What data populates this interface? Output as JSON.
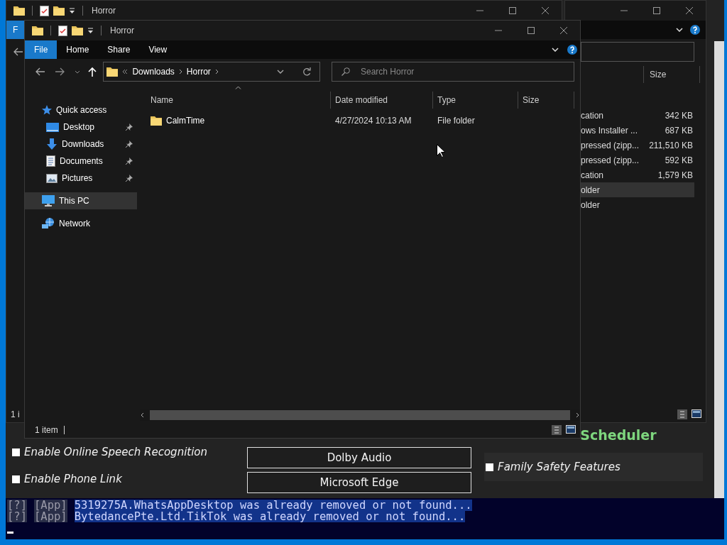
{
  "tweaks_window": {
    "checkboxes": [
      {
        "label": "Enable Online Speech Recognition",
        "checked": false
      },
      {
        "label": "Enable Phone Link",
        "checked": false
      }
    ],
    "buttons": [
      "Dolby Audio",
      "Microsoft Edge"
    ],
    "heading": "Scheduler",
    "options": [
      {
        "label": "Family Safety Features",
        "checked": false
      }
    ]
  },
  "console": {
    "lines": [
      {
        "tag": "[?]",
        "source": "[App]",
        "message": "5319275A.WhatsAppDesktop was already removed or not found...",
        "selected": true
      },
      {
        "tag": "[?]",
        "source": "[App]",
        "message": "BytedancePte.Ltd.TikTok was already removed or not found...",
        "selected": true
      }
    ]
  },
  "rear_explorer": {
    "title": "Horror",
    "ribbon_tab": "F",
    "status": "1 i"
  },
  "side_explorer": {
    "column": "Size",
    "rows": [
      {
        "type": "cation",
        "size": "342 KB",
        "selected": false
      },
      {
        "type": "ows Installer ...",
        "size": "687 KB",
        "selected": false
      },
      {
        "type": "pressed (zipp...",
        "size": "211,510 KB",
        "selected": false
      },
      {
        "type": "pressed (zipp...",
        "size": "592 KB",
        "selected": false
      },
      {
        "type": "cation",
        "size": "1,579 KB",
        "selected": false
      },
      {
        "type": "older",
        "selected": true
      },
      {
        "type": "older",
        "selected": false
      }
    ]
  },
  "explorer": {
    "title": "Horror",
    "ribbon_tabs": [
      {
        "label": "File",
        "selected": true
      },
      {
        "label": "Home",
        "selected": false
      },
      {
        "label": "Share",
        "selected": false
      },
      {
        "label": "View",
        "selected": false
      }
    ],
    "address": [
      "Downloads",
      "Horror"
    ],
    "search": {
      "placeholder": "Search Horror"
    },
    "nav": [
      {
        "label": "Quick access",
        "kind": "star",
        "selected": false,
        "children": [
          {
            "label": "Desktop",
            "kind": "desktop",
            "pinned": true,
            "selected": false
          },
          {
            "label": "Downloads",
            "kind": "download",
            "pinned": true,
            "selected": false
          },
          {
            "label": "Documents",
            "kind": "document",
            "pinned": true,
            "selected": false
          },
          {
            "label": "Pictures",
            "kind": "picture",
            "pinned": true,
            "selected": false
          }
        ]
      },
      {
        "label": "This PC",
        "kind": "pc",
        "selected": true
      },
      {
        "label": "Network",
        "kind": "network",
        "selected": false
      }
    ],
    "columns": [
      "Name",
      "Date modified",
      "Type",
      "Size"
    ],
    "rows": [
      {
        "name": "CalmTime",
        "date": "4/27/2024 10:13 AM",
        "type": "File folder",
        "selected": false
      }
    ],
    "status": "1 item"
  }
}
